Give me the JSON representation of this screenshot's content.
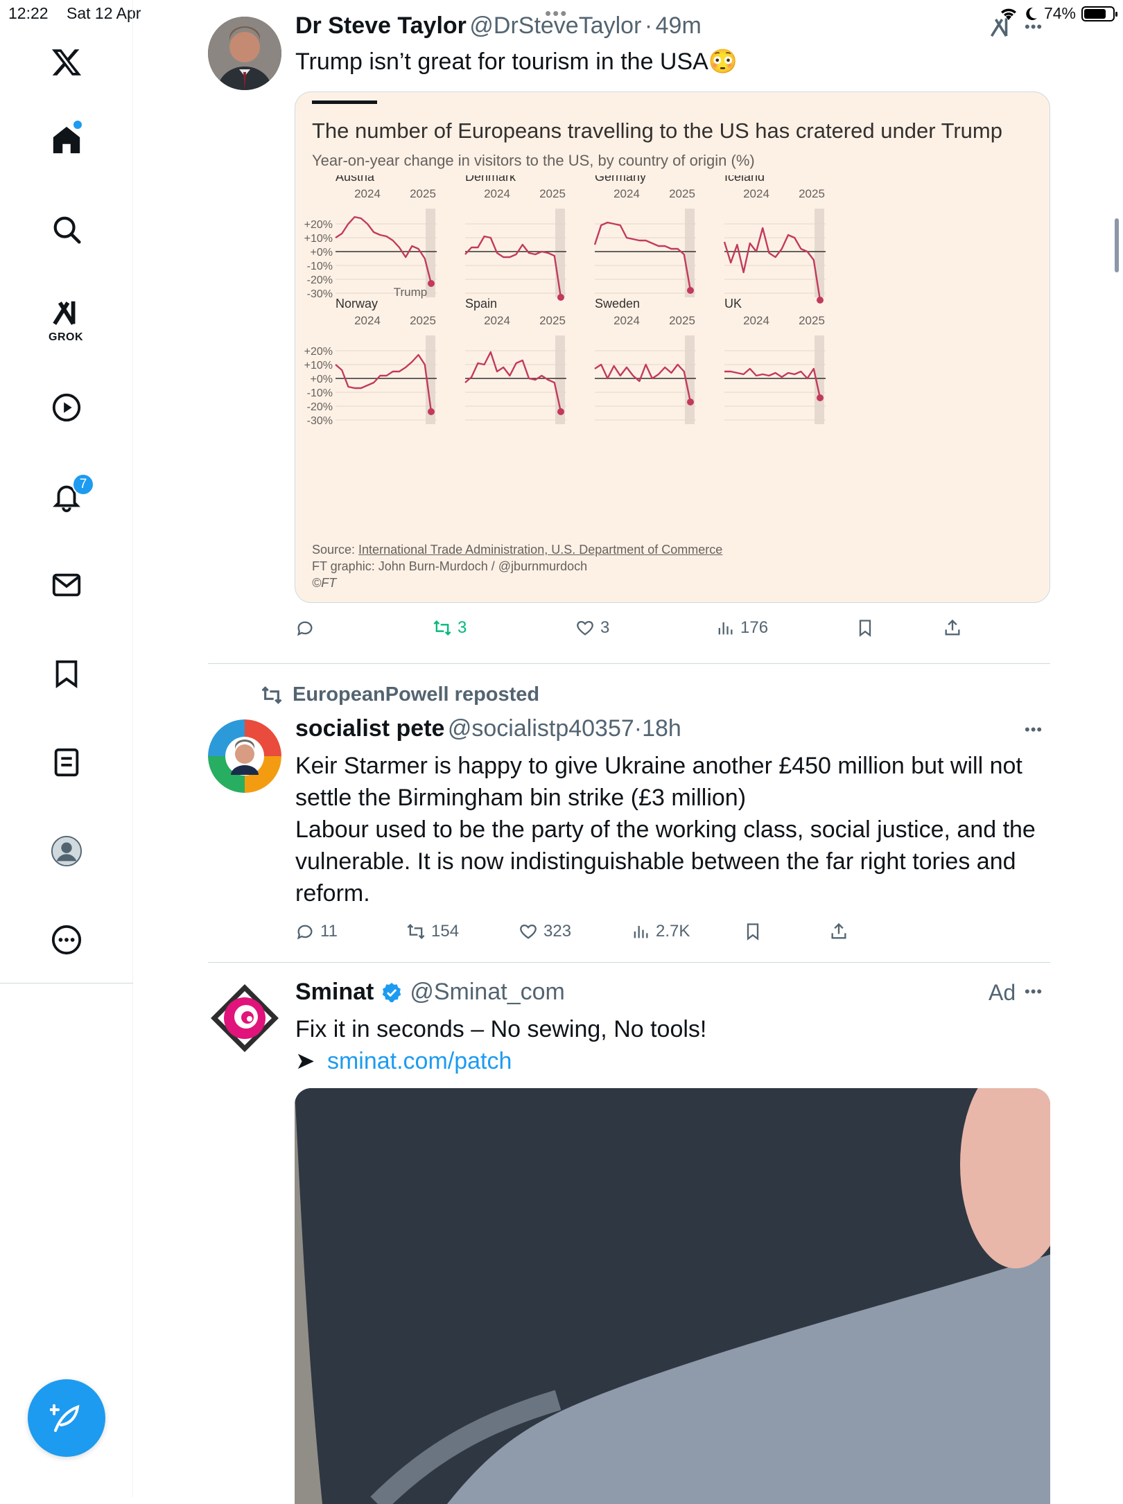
{
  "status_bar": {
    "time": "12:22",
    "date": "Sat 12 Apr",
    "battery": "74%",
    "battery_level": 0.74
  },
  "nav": {
    "items": [
      "home-icon",
      "search-icon",
      "grok-icon",
      "video-icon",
      "notifications-icon",
      "messages-icon",
      "bookmarks-icon",
      "lists-icon",
      "profile-icon",
      "more-icon"
    ],
    "grok_label": "GROK",
    "notifications_count": "7"
  },
  "posts": [
    {
      "name": "Dr Steve Taylor",
      "handle": "@DrSteveTaylor",
      "sep": "·",
      "time": "49m",
      "text": "Trump isn’t great for tourism in the USA😳",
      "stats": {
        "replies": "",
        "reposts": "3",
        "likes": "3",
        "views": "176"
      }
    },
    {
      "reposted_by": "EuropeanPowell reposted",
      "name": "socialist pete",
      "handle": "@socialistp40357",
      "sep": "·",
      "time": "18h",
      "text_lines": [
        "Keir Starmer is happy to give Ukraine another £450 million but will not",
        "settle the Birmingham bin strike (£3 million)",
        "Labour used to be the party of the working class, social justice, and the",
        "vulnerable. It is now indistinguishable between the far right tories and",
        "reform."
      ],
      "stats": {
        "replies": "11",
        "reposts": "154",
        "likes": "323",
        "views": "2.7K"
      }
    },
    {
      "name": "Sminat",
      "handle": "@Sminat_com",
      "ad_label": "Ad",
      "text": "Fix it in seconds – No sewing, No tools!",
      "arrow": "➤",
      "link": "sminat.com/patch"
    }
  ],
  "chart_card": {
    "title": "The number of Europeans travelling to the US has cratered under Trump",
    "subtitle": "Year-on-year change in visitors to the US, by country of origin (%)",
    "source_prefix": "Source: ",
    "source_link": "International Trade Administration, U.S. Department of Commerce",
    "credit": "FT graphic: John Burn-Murdoch / @jburnmurdoch",
    "copyright": "©FT",
    "annotation": "Trump"
  },
  "chart_data": {
    "type": "line",
    "title": "The number of Europeans travelling to the US has cratered under Trump",
    "subtitle": "Year-on-year change in visitors to the US, by country of origin (%)",
    "ylabel": "",
    "ylim": [
      -30,
      20
    ],
    "yticks": [
      "+20%",
      "+10%",
      "+0%",
      "-10%",
      "-20%",
      "-30%"
    ],
    "ytick_values": [
      20,
      10,
      0,
      -10,
      -20,
      -30
    ],
    "xtick_labels": [
      "2024",
      "2025"
    ],
    "annotation": "Trump",
    "colors": {
      "line": "#c23a5b",
      "shade": "#e6dad0",
      "zero": "#33302e",
      "grid": "#e2d5c9"
    },
    "panels": [
      {
        "name": "Austria",
        "values": [
          10,
          13,
          20,
          25,
          24,
          20,
          14,
          12,
          11,
          8,
          3,
          -4,
          4,
          2,
          -5,
          -23
        ]
      },
      {
        "name": "Denmark",
        "values": [
          -2,
          3,
          3,
          11,
          10,
          -1,
          -4,
          -4,
          -2,
          5,
          -1,
          -2,
          0,
          -1,
          -3,
          -33
        ]
      },
      {
        "name": "Germany",
        "values": [
          5,
          19,
          21,
          20,
          19,
          10,
          9,
          8,
          8,
          6,
          4,
          4,
          2,
          2,
          -2,
          -28
        ]
      },
      {
        "name": "Iceland",
        "values": [
          7,
          -8,
          5,
          -15,
          6,
          0,
          17,
          -1,
          -4,
          2,
          12,
          10,
          2,
          0,
          -6,
          -35
        ]
      },
      {
        "name": "Norway",
        "values": [
          10,
          6,
          -6,
          -7,
          -7,
          -5,
          -3,
          2,
          2,
          5,
          5,
          8,
          12,
          17,
          10,
          -24
        ]
      },
      {
        "name": "Spain",
        "values": [
          -3,
          1,
          11,
          10,
          19,
          5,
          8,
          2,
          11,
          13,
          0,
          -1,
          2,
          -1,
          -3,
          -24
        ]
      },
      {
        "name": "Sweden",
        "values": [
          7,
          10,
          0,
          9,
          2,
          8,
          2,
          -2,
          10,
          0,
          3,
          8,
          4,
          10,
          5,
          -17
        ]
      },
      {
        "name": "UK",
        "values": [
          5,
          5,
          4,
          3,
          7,
          2,
          3,
          2,
          4,
          1,
          4,
          3,
          5,
          0,
          7,
          -14
        ]
      }
    ]
  }
}
